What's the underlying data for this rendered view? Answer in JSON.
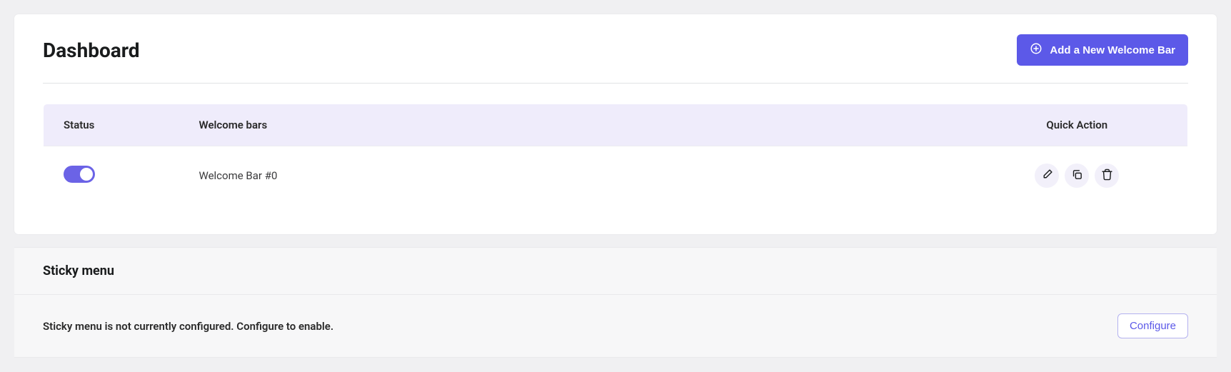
{
  "header": {
    "title": "Dashboard",
    "add_button_label": "Add a New Welcome Bar"
  },
  "table": {
    "columns": {
      "status": "Status",
      "name": "Welcome bars",
      "action": "Quick Action"
    },
    "rows": [
      {
        "enabled": true,
        "name": "Welcome Bar #0"
      }
    ]
  },
  "sticky": {
    "title": "Sticky menu",
    "message": "Sticky menu is not currently configured. Configure to enable.",
    "configure_label": "Configure"
  }
}
